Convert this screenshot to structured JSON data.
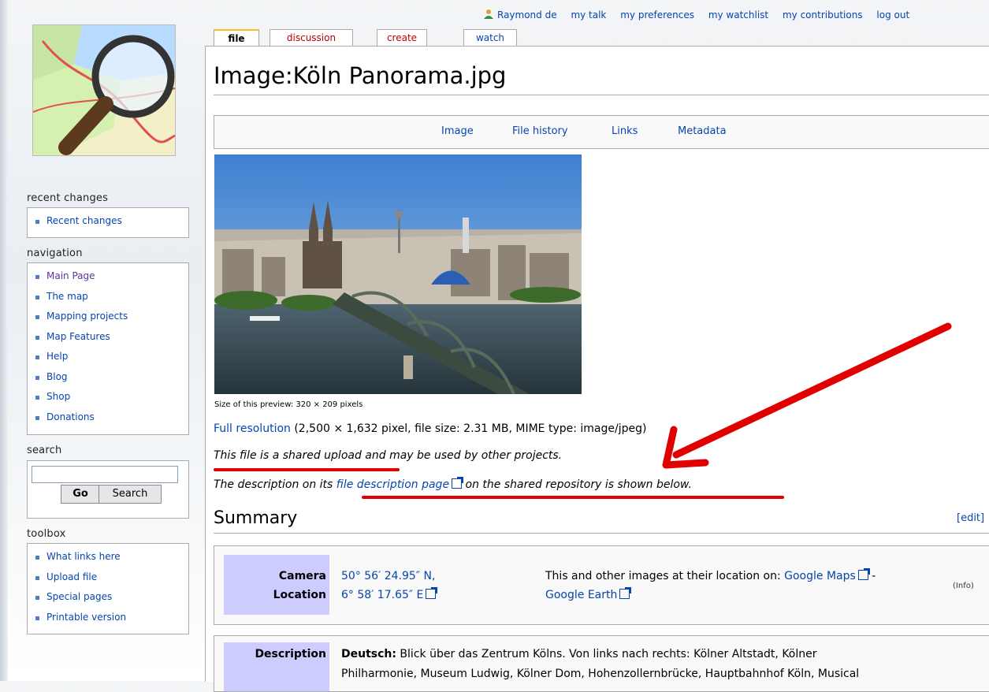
{
  "personal_tools": {
    "user": "Raymond de",
    "talk": "my talk",
    "preferences": "my preferences",
    "watchlist": "my watchlist",
    "contributions": "my contributions",
    "logout": "log out"
  },
  "tabs": {
    "file": "file",
    "discussion": "discussion",
    "create": "create",
    "watch": "watch"
  },
  "sidebar": {
    "recent_title": "recent changes",
    "recent_items": [
      "Recent changes"
    ],
    "nav_title": "navigation",
    "nav_items": [
      "Main Page",
      "The map",
      "Mapping projects",
      "Map Features",
      "Help",
      "Blog",
      "Shop",
      "Donations"
    ],
    "search_title": "search",
    "go_label": "Go",
    "search_label": "Search",
    "toolbox_title": "toolbox",
    "toolbox_items": [
      "What links here",
      "Upload file",
      "Special pages",
      "Printable version"
    ]
  },
  "page": {
    "title": "Image:Köln Panorama.jpg",
    "filetoc": [
      "Image",
      "File history",
      "Links",
      "Metadata"
    ],
    "caption": "Size of this preview: 320 × 209 pixels",
    "fullres_link": "Full resolution",
    "fullres_rest": " (2,500 × 1,632 pixel, file size: 2.31 MB, MIME type: image/jpeg)",
    "shared_text": "This file is a shared upload and may be used by other projects.",
    "desc_before": "The description on its ",
    "desc_link": "file description page",
    "desc_after": " on the shared repository is shown below.",
    "summary": "Summary",
    "edit": "[edit]",
    "camera_label_1": "Camera",
    "camera_label_2": "Location",
    "coord_1": "50° 56′ 24.95″ N,",
    "coord_2": "6° 58′ 17.65″ E",
    "location_text": "This and other images at their location on: ",
    "google_maps": "Google Maps",
    "dash": " -",
    "google_earth": "Google Earth",
    "info": "(Info)",
    "description_label": "Description",
    "desc_lang": "Deutsch:",
    "desc_line1": " Blick über das Zentrum Kölns. Von links nach rechts: Kölner Altstadt, Kölner",
    "desc_line2": "Philharmonie, Museum Ludwig, Kölner Dom, Hohenzollernbrücke, Hauptbahnhof Köln, Musical"
  },
  "colors": {
    "link": "#0645ad",
    "annotation": "#e00000",
    "label_bg": "#ccccff"
  }
}
